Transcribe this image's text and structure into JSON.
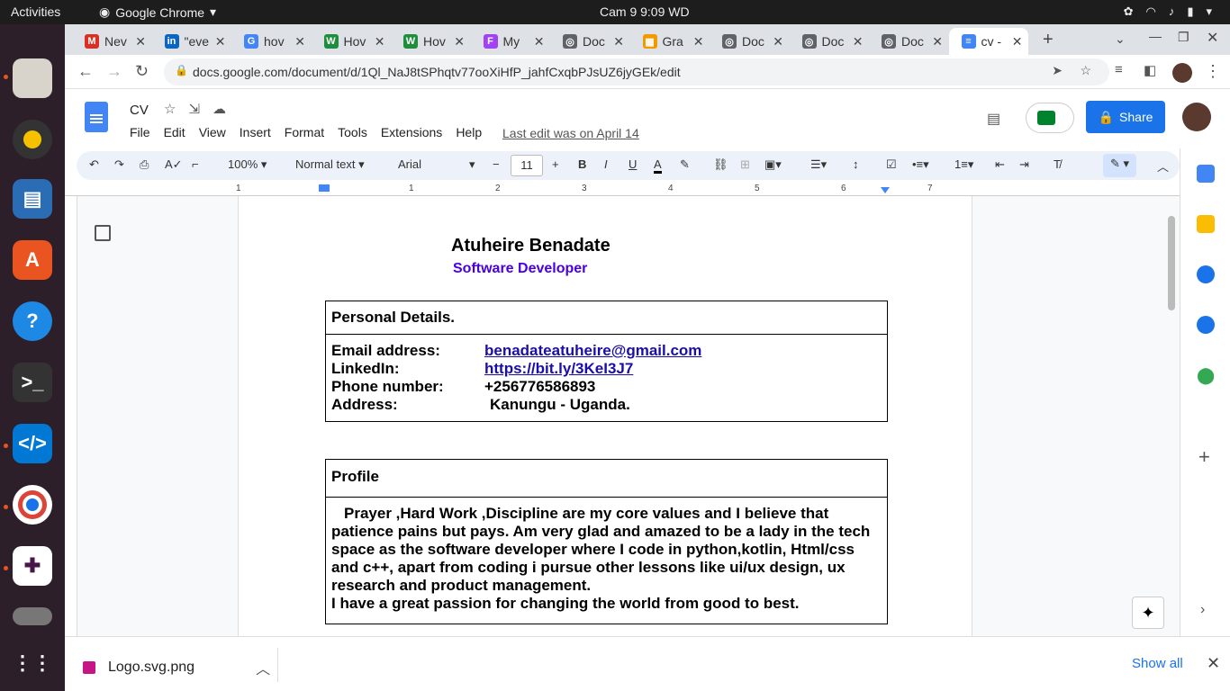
{
  "system": {
    "activities": "Activities",
    "app": "Google Chrome",
    "clock": "Cam 9   9:09 WD"
  },
  "browser": {
    "tabs": [
      {
        "title": "Nev",
        "color": "#d93025",
        "glyph": "M"
      },
      {
        "title": "\"eve",
        "color": "#0a66c2",
        "glyph": "in"
      },
      {
        "title": "hov",
        "color": "#4285f4",
        "glyph": "G"
      },
      {
        "title": "Hov",
        "color": "#1e8e3e",
        "glyph": "W"
      },
      {
        "title": "Hov",
        "color": "#1e8e3e",
        "glyph": "W"
      },
      {
        "title": "My",
        "color": "#a142f4",
        "glyph": "F"
      },
      {
        "title": "Doc",
        "color": "#5f6368",
        "glyph": "◎"
      },
      {
        "title": "Gra",
        "color": "#f29900",
        "glyph": "▦"
      },
      {
        "title": "Doc",
        "color": "#5f6368",
        "glyph": "◎"
      },
      {
        "title": "Doc",
        "color": "#5f6368",
        "glyph": "◎"
      },
      {
        "title": "Doc",
        "color": "#5f6368",
        "glyph": "◎"
      },
      {
        "title": "cv -",
        "color": "#4285f4",
        "glyph": "≡"
      }
    ],
    "url": "docs.google.com/document/d/1Ql_NaJ8tSPhqtv77ooXiHfP_jahfCxqbPJsUZ6jyGEk/edit"
  },
  "docs": {
    "title": "CV",
    "menu": [
      "File",
      "Edit",
      "View",
      "Insert",
      "Format",
      "Tools",
      "Extensions",
      "Help"
    ],
    "last_edit": "Last edit was on April 14",
    "share_label": "Share",
    "zoom": "100%",
    "style": "Normal text",
    "font": "Arial",
    "font_size": "11"
  },
  "ruler_marks": [
    "1",
    "1",
    "2",
    "3",
    "4",
    "5",
    "6",
    "7"
  ],
  "document": {
    "name": "Atuheire Benadate",
    "role": "Software Developer",
    "personal": {
      "heading": "Personal Details.",
      "email_label": "Email address:",
      "email": "benadateatuheire@gmail.com",
      "linkedin_label": "LinkedIn:",
      "linkedin": "https://bit.ly/3KeI3J7",
      "phone_label": "Phone number:",
      "phone": "+256776586893",
      "address_label": "Address:",
      "address": "Kanungu - Uganda."
    },
    "profile": {
      "heading": "Profile",
      "body": "Prayer ,Hard Work ,Discipline are my core values and I believe that patience pains but pays. Am very glad and amazed to be a lady in the tech space as the software developer where I code in python,kotlin, Html/css and c++, apart from coding i pursue other lessons like ui/ux design, ux research and product management.",
      "body2": "I have a great passion for changing the world from good to best."
    }
  },
  "downloads": {
    "file": "Logo.svg.png",
    "show_all": "Show all"
  }
}
